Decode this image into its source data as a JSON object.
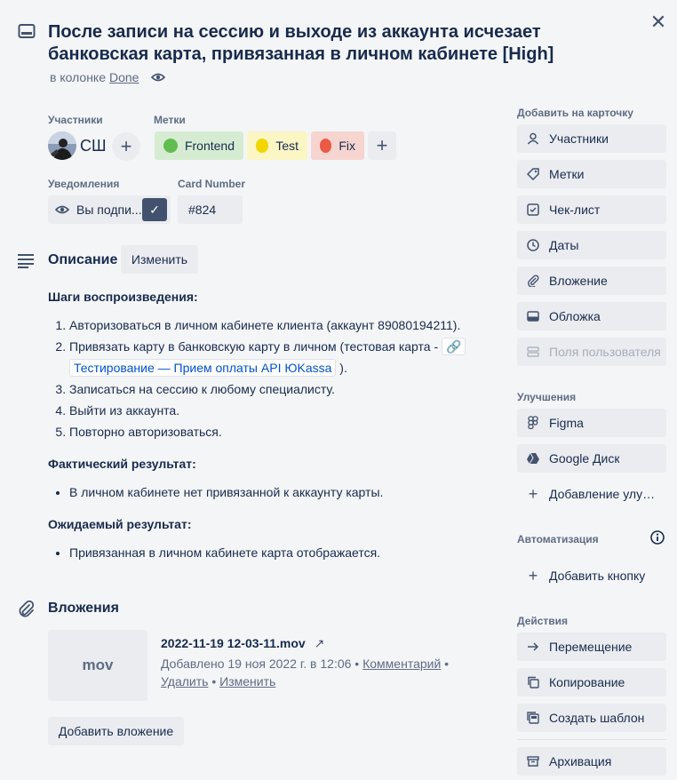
{
  "card": {
    "title": "После записи на сессию и выходе из аккаунта исчезает банковская карта, привязанная в личном кабинете [High]",
    "column_prefix": "в колонке",
    "column_name": "Done"
  },
  "members": {
    "label": "Участники",
    "initials": "СШ"
  },
  "labels": {
    "label": "Метки",
    "items": [
      {
        "name": "Frontend",
        "color": "#61bd4f",
        "bg": "#d6ecd2"
      },
      {
        "name": "Test",
        "color": "#f2d600",
        "bg": "#fcf5c4"
      },
      {
        "name": "Fix",
        "color": "#eb5a46",
        "bg": "#f6d4cf"
      }
    ]
  },
  "notifications": {
    "label": "Уведомления",
    "button": "Вы подпи..."
  },
  "card_number": {
    "label": "Card Number",
    "value": "#824"
  },
  "description": {
    "title": "Описание",
    "edit": "Изменить",
    "steps_heading": "Шаги воспроизведения:",
    "steps": [
      "Авторизоваться в личном кабинете клиента (аккаунт 89080194211).",
      "Привязать карту в банковскую карту в личном (тестовая карта - ",
      "Записаться на сессию к любому специалисту.",
      "Выйти из аккаунта.",
      "Повторно авторизоваться."
    ],
    "link_text": "Тестирование — Прием оплаты API ЮKassa",
    "after_link": " ).",
    "actual_heading": "Фактический результат:",
    "actual": [
      "В личном кабинете нет привязанной к аккаунту карты."
    ],
    "expected_heading": "Ожидаемый результат:",
    "expected": [
      "Привязанная в личном кабинете карта отображается."
    ]
  },
  "attachments": {
    "title": "Вложения",
    "thumb_text": "mov",
    "file_name": "2022-11-19 12-03-11.mov",
    "added": "Добавлено 19 ноя 2022 г. в 12:06",
    "comment": "Комментарий",
    "delete": "Удалить",
    "edit": "Изменить",
    "add_button": "Добавить вложение"
  },
  "sidebar": {
    "add_heading": "Добавить на карточку",
    "add_items": [
      "Участники",
      "Метки",
      "Чек-лист",
      "Даты",
      "Вложение",
      "Обложка",
      "Поля пользователя"
    ],
    "powerups_heading": "Улучшения",
    "powerups": [
      "Figma",
      "Google Диск",
      "Добавление улучшений"
    ],
    "automation_heading": "Автоматизация",
    "automation_button": "Добавить кнопку",
    "actions_heading": "Действия",
    "actions": [
      "Перемещение",
      "Копирование",
      "Создать шаблон",
      "Архивация"
    ]
  }
}
